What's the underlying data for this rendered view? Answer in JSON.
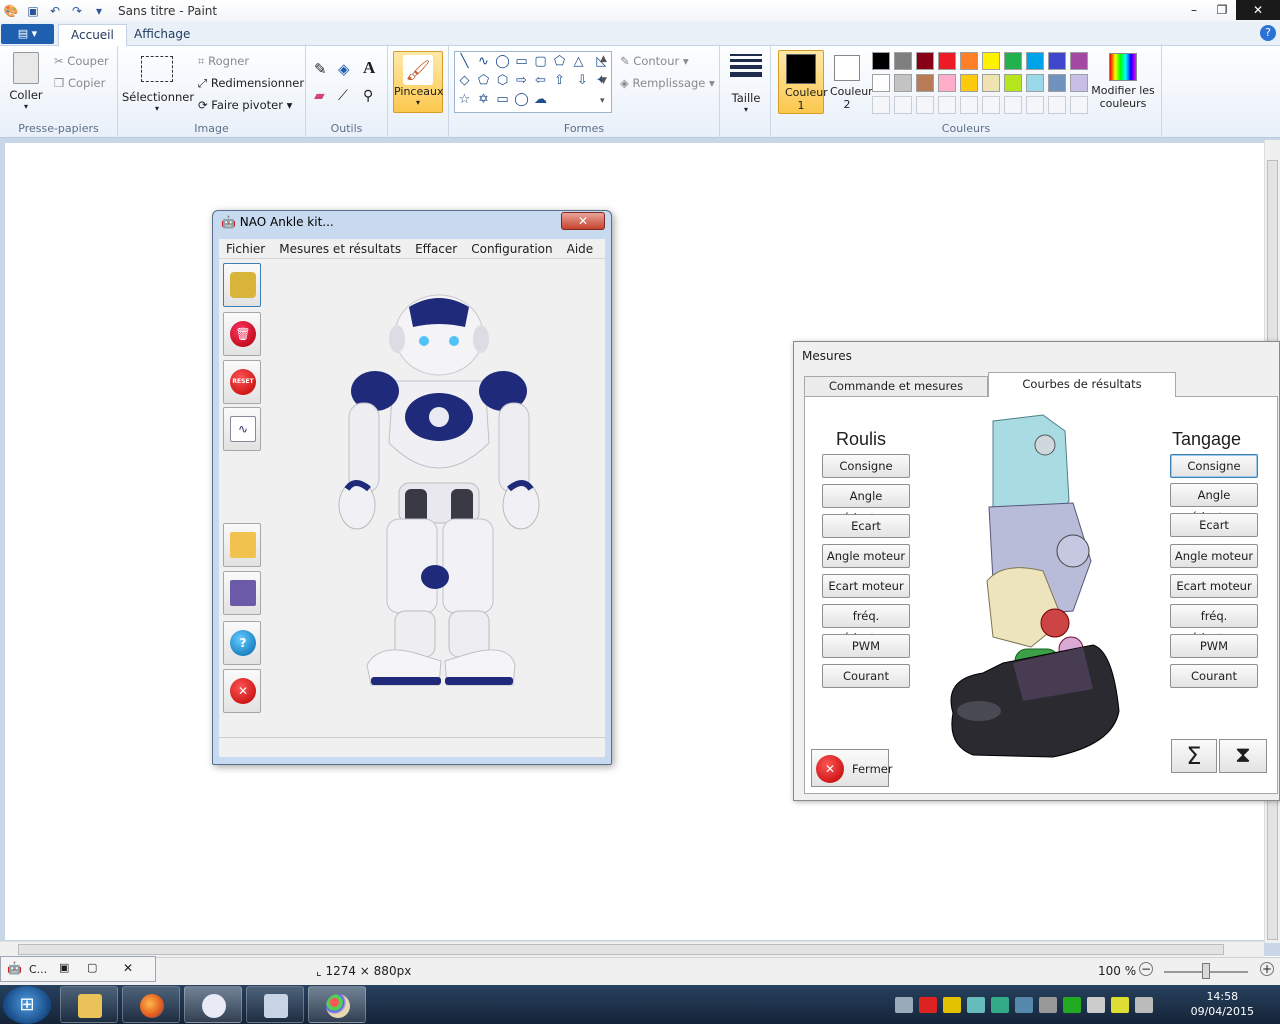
{
  "paint": {
    "title": "Sans titre - Paint",
    "tabs": [
      "Accueil",
      "Affichage"
    ],
    "clipboard": {
      "paste": "Coller",
      "cut": "Couper",
      "copy": "Copier",
      "group": "Presse-papiers"
    },
    "image": {
      "select": "Sélectionner",
      "crop": "Rogner",
      "resize": "Redimensionner",
      "rotate": "Faire pivoter",
      "group": "Image"
    },
    "tools": {
      "group": "Outils"
    },
    "brushes": {
      "label": "Pinceaux"
    },
    "shapes": {
      "outline": "Contour",
      "fill": "Remplissage",
      "group": "Formes"
    },
    "size": {
      "label": "Taille"
    },
    "colors": {
      "color1": "Couleur 1",
      "color2": "Couleur 2",
      "edit": "Modifier les couleurs",
      "group": "Couleurs",
      "color1_value": "#000000",
      "color2_value": "#ffffff",
      "palette_row1": [
        "#000000",
        "#7f7f7f",
        "#880015",
        "#ed1c24",
        "#ff7f27",
        "#fff200",
        "#22b14c",
        "#00a2e8",
        "#3f48cc",
        "#a349a4"
      ],
      "palette_row2": [
        "#ffffff",
        "#c3c3c3",
        "#b97a57",
        "#ffaec9",
        "#ffc90e",
        "#efe4b0",
        "#b5e61d",
        "#99d9ea",
        "#7092be",
        "#c8bfe7"
      ]
    },
    "status": {
      "image_size": "1274 × 880px",
      "zoom": "100 %"
    }
  },
  "nao_window": {
    "title": "NAO Ankle kit...",
    "menu": [
      "Fichier",
      "Mesures et résultats",
      "Effacer",
      "Configuration",
      "Aide"
    ],
    "toolbar_icons": [
      "measure-tape-icon",
      "delete-icon",
      "reset-icon",
      "curve-icon",
      "open-folder-icon",
      "save-icon",
      "help-icon",
      "close-icon"
    ],
    "reset_label": "RESET"
  },
  "mesures_window": {
    "title": "Mesures",
    "tabs": [
      "Commande et mesures",
      "Courbes de résultats"
    ],
    "active_tab": "Courbes de résultats",
    "roulis": {
      "heading": "Roulis",
      "buttons": [
        "Consigne",
        "Angle réducteur",
        "Ecart",
        "Angle moteur",
        "Ecart moteur",
        "fréq. réducteur",
        "PWM",
        "Courant"
      ]
    },
    "tangage": {
      "heading": "Tangage",
      "buttons": [
        "Consigne",
        "Angle réducteur",
        "Ecart",
        "Angle moteur",
        "Ecart moteur",
        "fréq. réducteur",
        "PWM",
        "Courant"
      ]
    },
    "close_button": "Fermer"
  },
  "taskbar": {
    "time": "14:58",
    "date": "09/04/2015",
    "mini_label": "C..."
  }
}
